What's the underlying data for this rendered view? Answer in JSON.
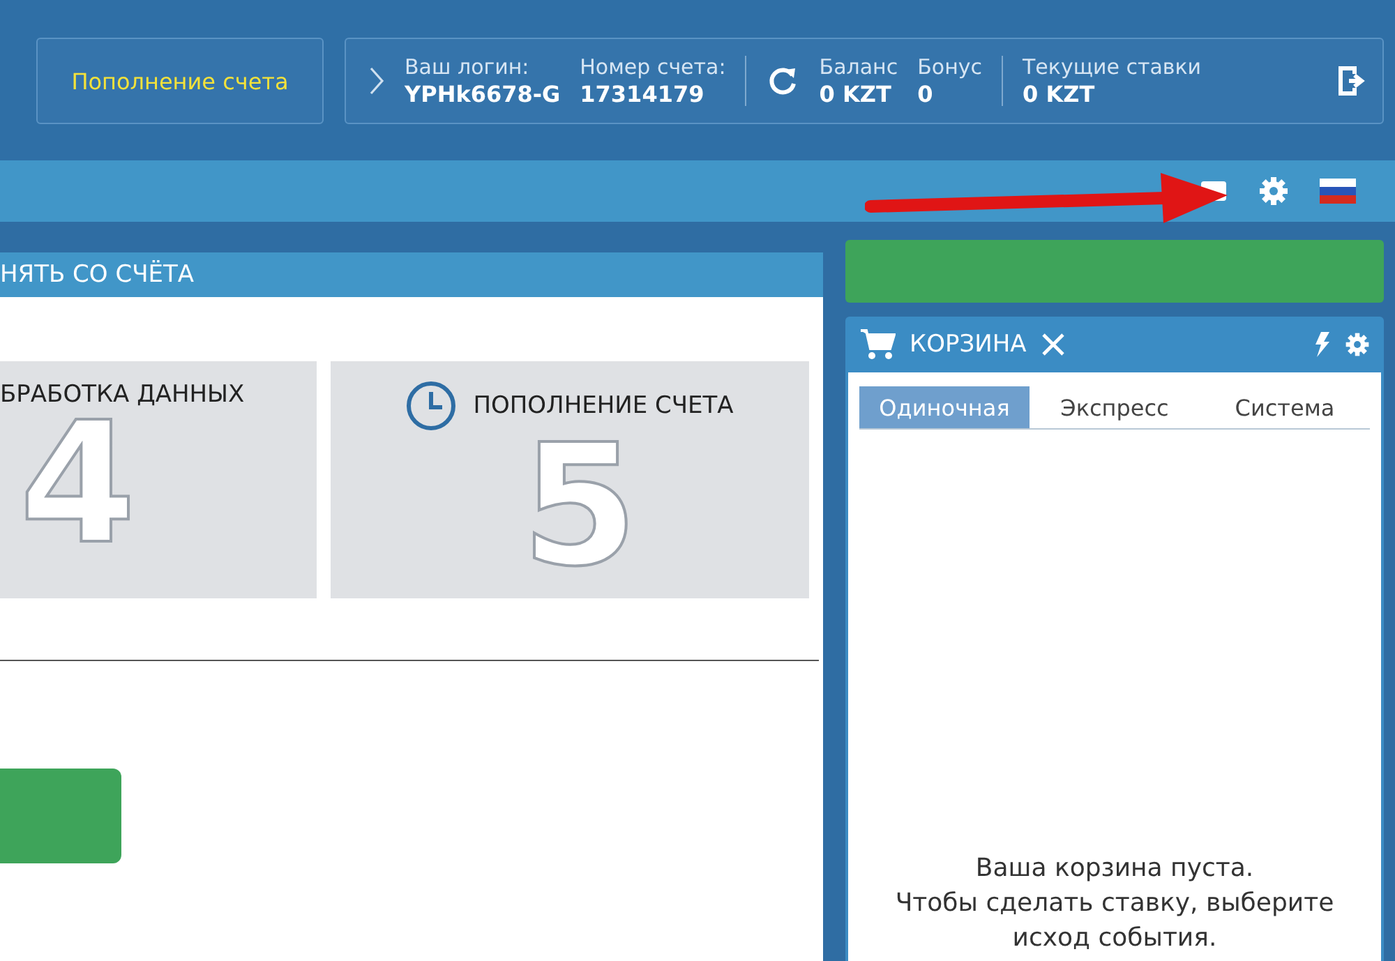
{
  "header": {
    "deposit_button": "Пополнение счета",
    "login_label": "Ваш логин:",
    "login": "YPHk6678-G",
    "account_label": "Номер счета:",
    "account": "17314179",
    "balance_label": "Баланс",
    "balance": "0 KZT",
    "bonus_label": "Бонус",
    "bonus": "0",
    "bets_label": "Текущие ставки",
    "bets": "0 KZT"
  },
  "left_panel": {
    "title": "НЯТЬ СО СЧЁТА",
    "steps": [
      {
        "title": "БРАБОТКА ДАННЫХ",
        "number": "4",
        "icon": false
      },
      {
        "title": "ПОПОЛНЕНИЕ СЧЕТА",
        "number": "5",
        "icon": true
      }
    ]
  },
  "cart": {
    "title": "КОРЗИНА",
    "tabs": [
      {
        "label": "Одиночная",
        "selected": true
      },
      {
        "label": "Экспресс",
        "selected": false
      },
      {
        "label": "Система",
        "selected": false
      }
    ],
    "empty_title": "Ваша корзина пуста.",
    "empty_hint": "Чтобы сделать ставку, выберите исход события."
  }
}
